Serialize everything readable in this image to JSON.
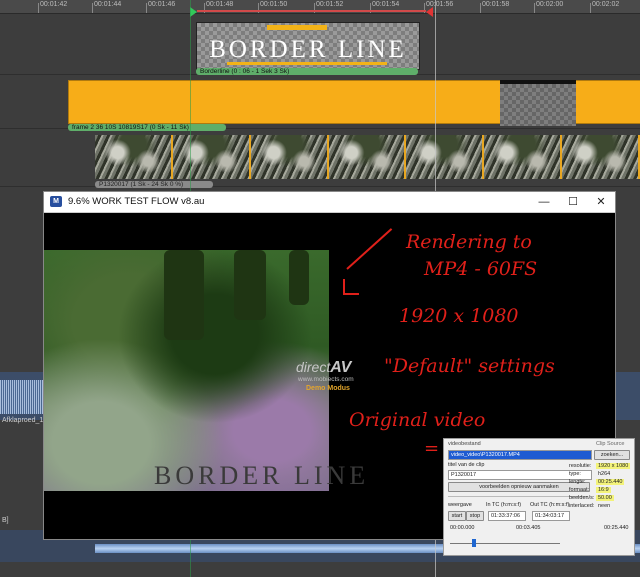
{
  "ruler": {
    "ticks": [
      "00:01:42",
      "00:01:44",
      "00:01:46",
      "00:01:48",
      "00:01:50",
      "00:01:52",
      "00:01:54",
      "00:01:56",
      "00:01:58",
      "00:02:00",
      "00:02:02"
    ]
  },
  "clips": {
    "title_text": "BORDER LINE",
    "title_label": "Borderline  (0 : 06 - 1 Sek 3 Sk)",
    "orange_label": "frame 2 36 10S 10819S17 (0 Sk - 11 Sk)",
    "video_label": "P1320017  (1 Sk - 24 Sk 0 %)",
    "audio_label": "Afklaproed_1",
    "lower_tag": "B]"
  },
  "preview": {
    "title": "9.6% WORK TEST FLOW v8.au",
    "icon": "M",
    "minimize": "—",
    "maximize": "☐",
    "close": "✕",
    "watermark": {
      "brand": "direct",
      "brand_suffix": "AV",
      "url": "www.mobiects.com",
      "demo": "Demo Modus"
    },
    "ghost_title": "BORDER LINE"
  },
  "notes": {
    "line1": "Rendering to",
    "line2": "MP4 - 60FS",
    "line3": "1920 x 1080",
    "line4": "\"Default\" settings",
    "line5": "Original video",
    "line6": "="
  },
  "props": {
    "header": "videobestand",
    "file_value": "video_video\\P1320017.MP4",
    "zoek_label": "Clip Source",
    "zoek_button": "zoeken...",
    "title_label": "titel van de clip",
    "clip_title": "P1320017",
    "preview_button": "voorbeelden opnieuw aanmaken",
    "weergave_label": "weergave",
    "in_label": "In TC (h:m:s:f)",
    "out_label": "Out TC (h:m:s:f)",
    "start_button": "start",
    "stop_button": "stop",
    "in_tc": "01:33:37:06",
    "out_tc": "01:34:03:17",
    "pos_start": "00:00.000",
    "pos_mid": "00:03.405",
    "pos_end": "00:25.440",
    "rows": [
      {
        "label": "resolutie:",
        "value": "1920 x 1080"
      },
      {
        "label": "type:",
        "value": "h264"
      },
      {
        "label": "lengte:",
        "value": "00:25.440"
      },
      {
        "label": "formaat:",
        "value": "16:9"
      },
      {
        "label": "beelden/s:",
        "value": "50.00"
      },
      {
        "label": "interlaced:",
        "value": "neen"
      }
    ]
  },
  "colors": {
    "clip_orange": "#f7ad18",
    "annotation_red": "#e0201a",
    "marker_green": "#32c85a"
  }
}
